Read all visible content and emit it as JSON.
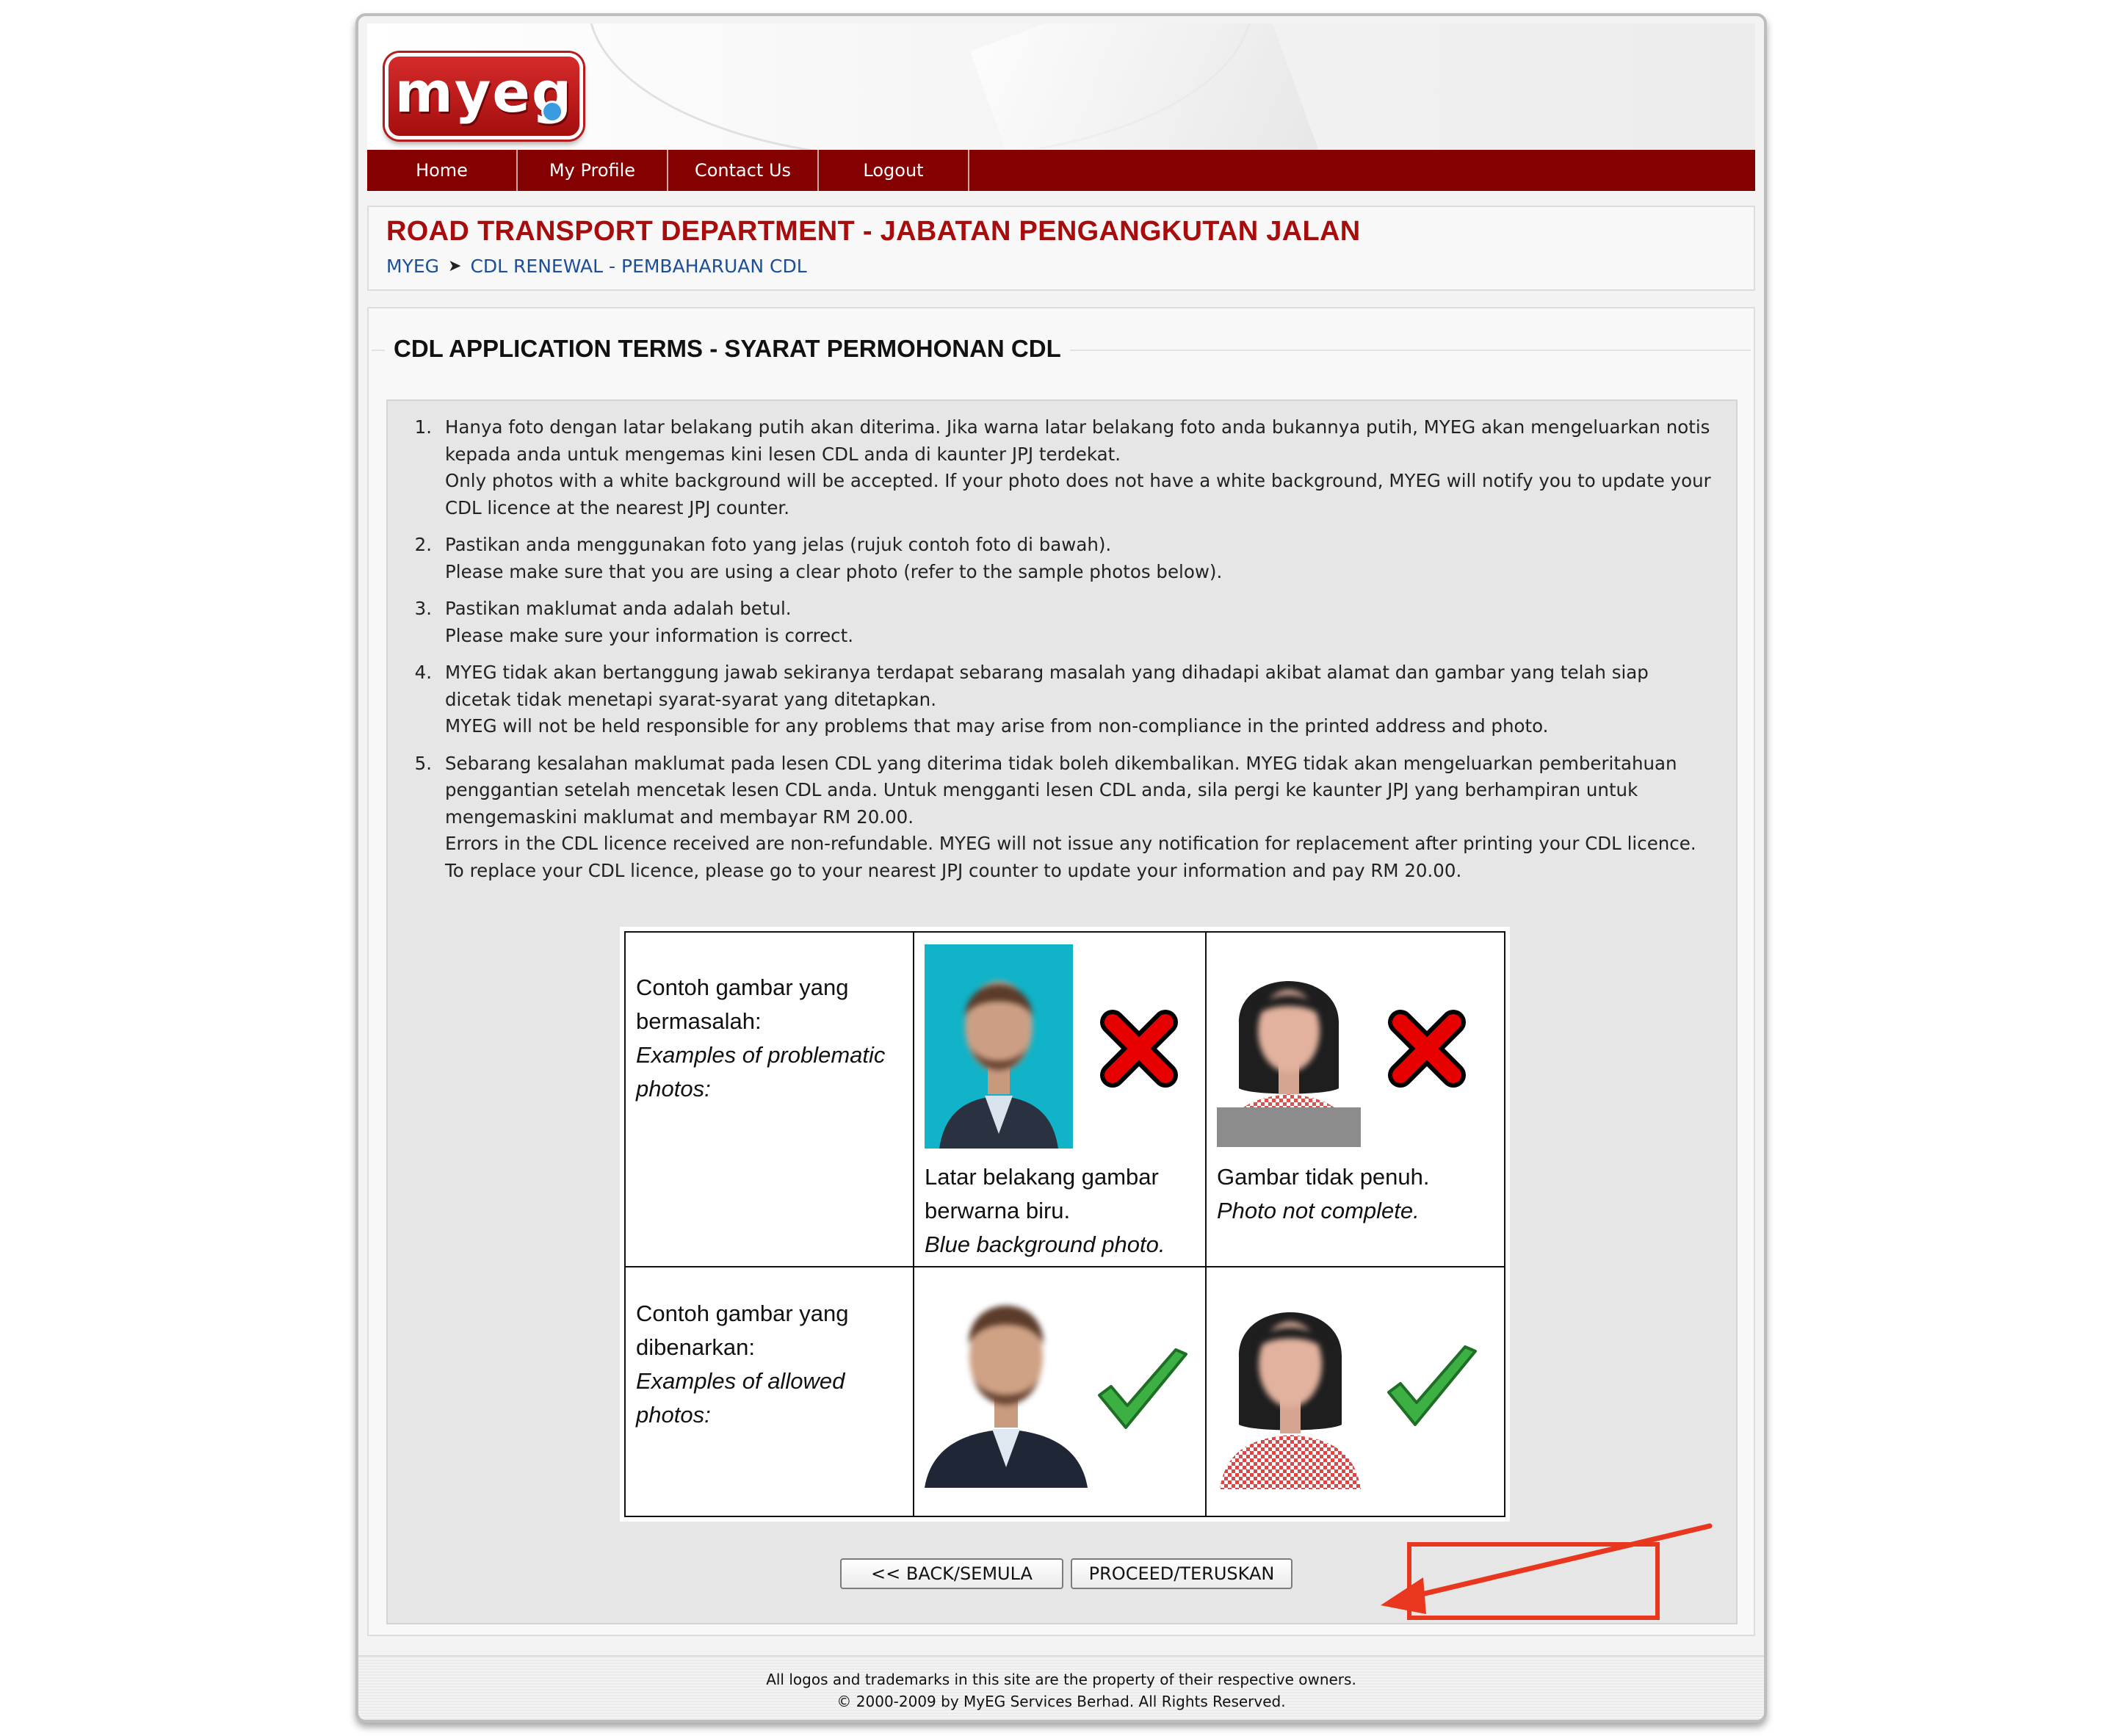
{
  "logo": {
    "text": "myeg"
  },
  "nav": {
    "items": [
      {
        "label": "Home"
      },
      {
        "label": "My Profile"
      },
      {
        "label": "Contact Us"
      },
      {
        "label": "Logout"
      }
    ]
  },
  "header": {
    "title": "ROAD TRANSPORT DEPARTMENT - JABATAN PENGANGKUTAN JALAN",
    "breadcrumb": {
      "root": "MYEG",
      "separator": "➤",
      "current": "CDL RENEWAL - PEMBAHARUAN CDL"
    }
  },
  "section": {
    "title": "CDL APPLICATION TERMS - SYARAT PERMOHONAN CDL"
  },
  "terms": [
    {
      "num": "1.",
      "ms": "Hanya foto dengan latar belakang putih akan diterima. Jika warna latar belakang foto anda bukannya putih, MYEG akan mengeluarkan notis kepada anda untuk mengemas kini lesen CDL anda di kaunter JPJ terdekat.",
      "en": "Only photos with a white background will be accepted. If your photo does not have a white background, MYEG will notify you to update your CDL licence at the nearest JPJ counter."
    },
    {
      "num": "2.",
      "ms": "Pastikan anda menggunakan foto yang jelas (rujuk contoh foto di bawah).",
      "en": "Please make sure that you are using a clear photo (refer to the sample photos below)."
    },
    {
      "num": "3.",
      "ms": "Pastikan maklumat anda adalah betul.",
      "en": "Please make sure your information is correct."
    },
    {
      "num": "4.",
      "ms": "MYEG tidak akan bertanggung jawab sekiranya terdapat sebarang masalah yang dihadapi akibat alamat dan gambar yang telah siap dicetak tidak menetapi syarat-syarat yang ditetapkan.",
      "en": "MYEG will not be held responsible for any problems that may arise from non-compliance in the printed address and photo."
    },
    {
      "num": "5.",
      "ms": "Sebarang kesalahan maklumat pada lesen CDL yang diterima tidak boleh dikembalikan. MYEG tidak akan mengeluarkan pemberitahuan penggantian setelah mencetak lesen CDL anda. Untuk mengganti lesen CDL anda, sila pergi ke kaunter JPJ yang berhampiran untuk mengemaskini maklumat and membayar RM 20.00.",
      "en": "Errors in the CDL licence received are non-refundable. MYEG will not issue any notification for replacement after printing your CDL licence. To replace your CDL licence, please go to your nearest JPJ counter to update your information and pay RM 20.00."
    }
  ],
  "samples": {
    "problematic": {
      "label_ms": "Contoh gambar yang bermasalah:",
      "label_en": "Examples of problematic photos:",
      "photo1_caption_ms": "Latar belakang gambar berwarna biru.",
      "photo1_caption_en": "Blue background photo.",
      "photo2_caption_ms": "Gambar tidak penuh.",
      "photo2_caption_en": "Photo not complete."
    },
    "allowed": {
      "label_ms": "Contoh gambar yang dibenarkan:",
      "label_en": "Examples of allowed photos:"
    },
    "colors": {
      "reject": "#e60000",
      "accept": "#3cb043",
      "blue_background": "#10b3c8"
    }
  },
  "buttons": {
    "back": "<< BACK/SEMULA",
    "proceed": "PROCEED/TERUSKAN"
  },
  "footer": {
    "line1": "All logos and trademarks in this site are the property of their respective owners.",
    "line2": "© 2000-2009 by MyEG Services Berhad. All Rights Reserved."
  }
}
